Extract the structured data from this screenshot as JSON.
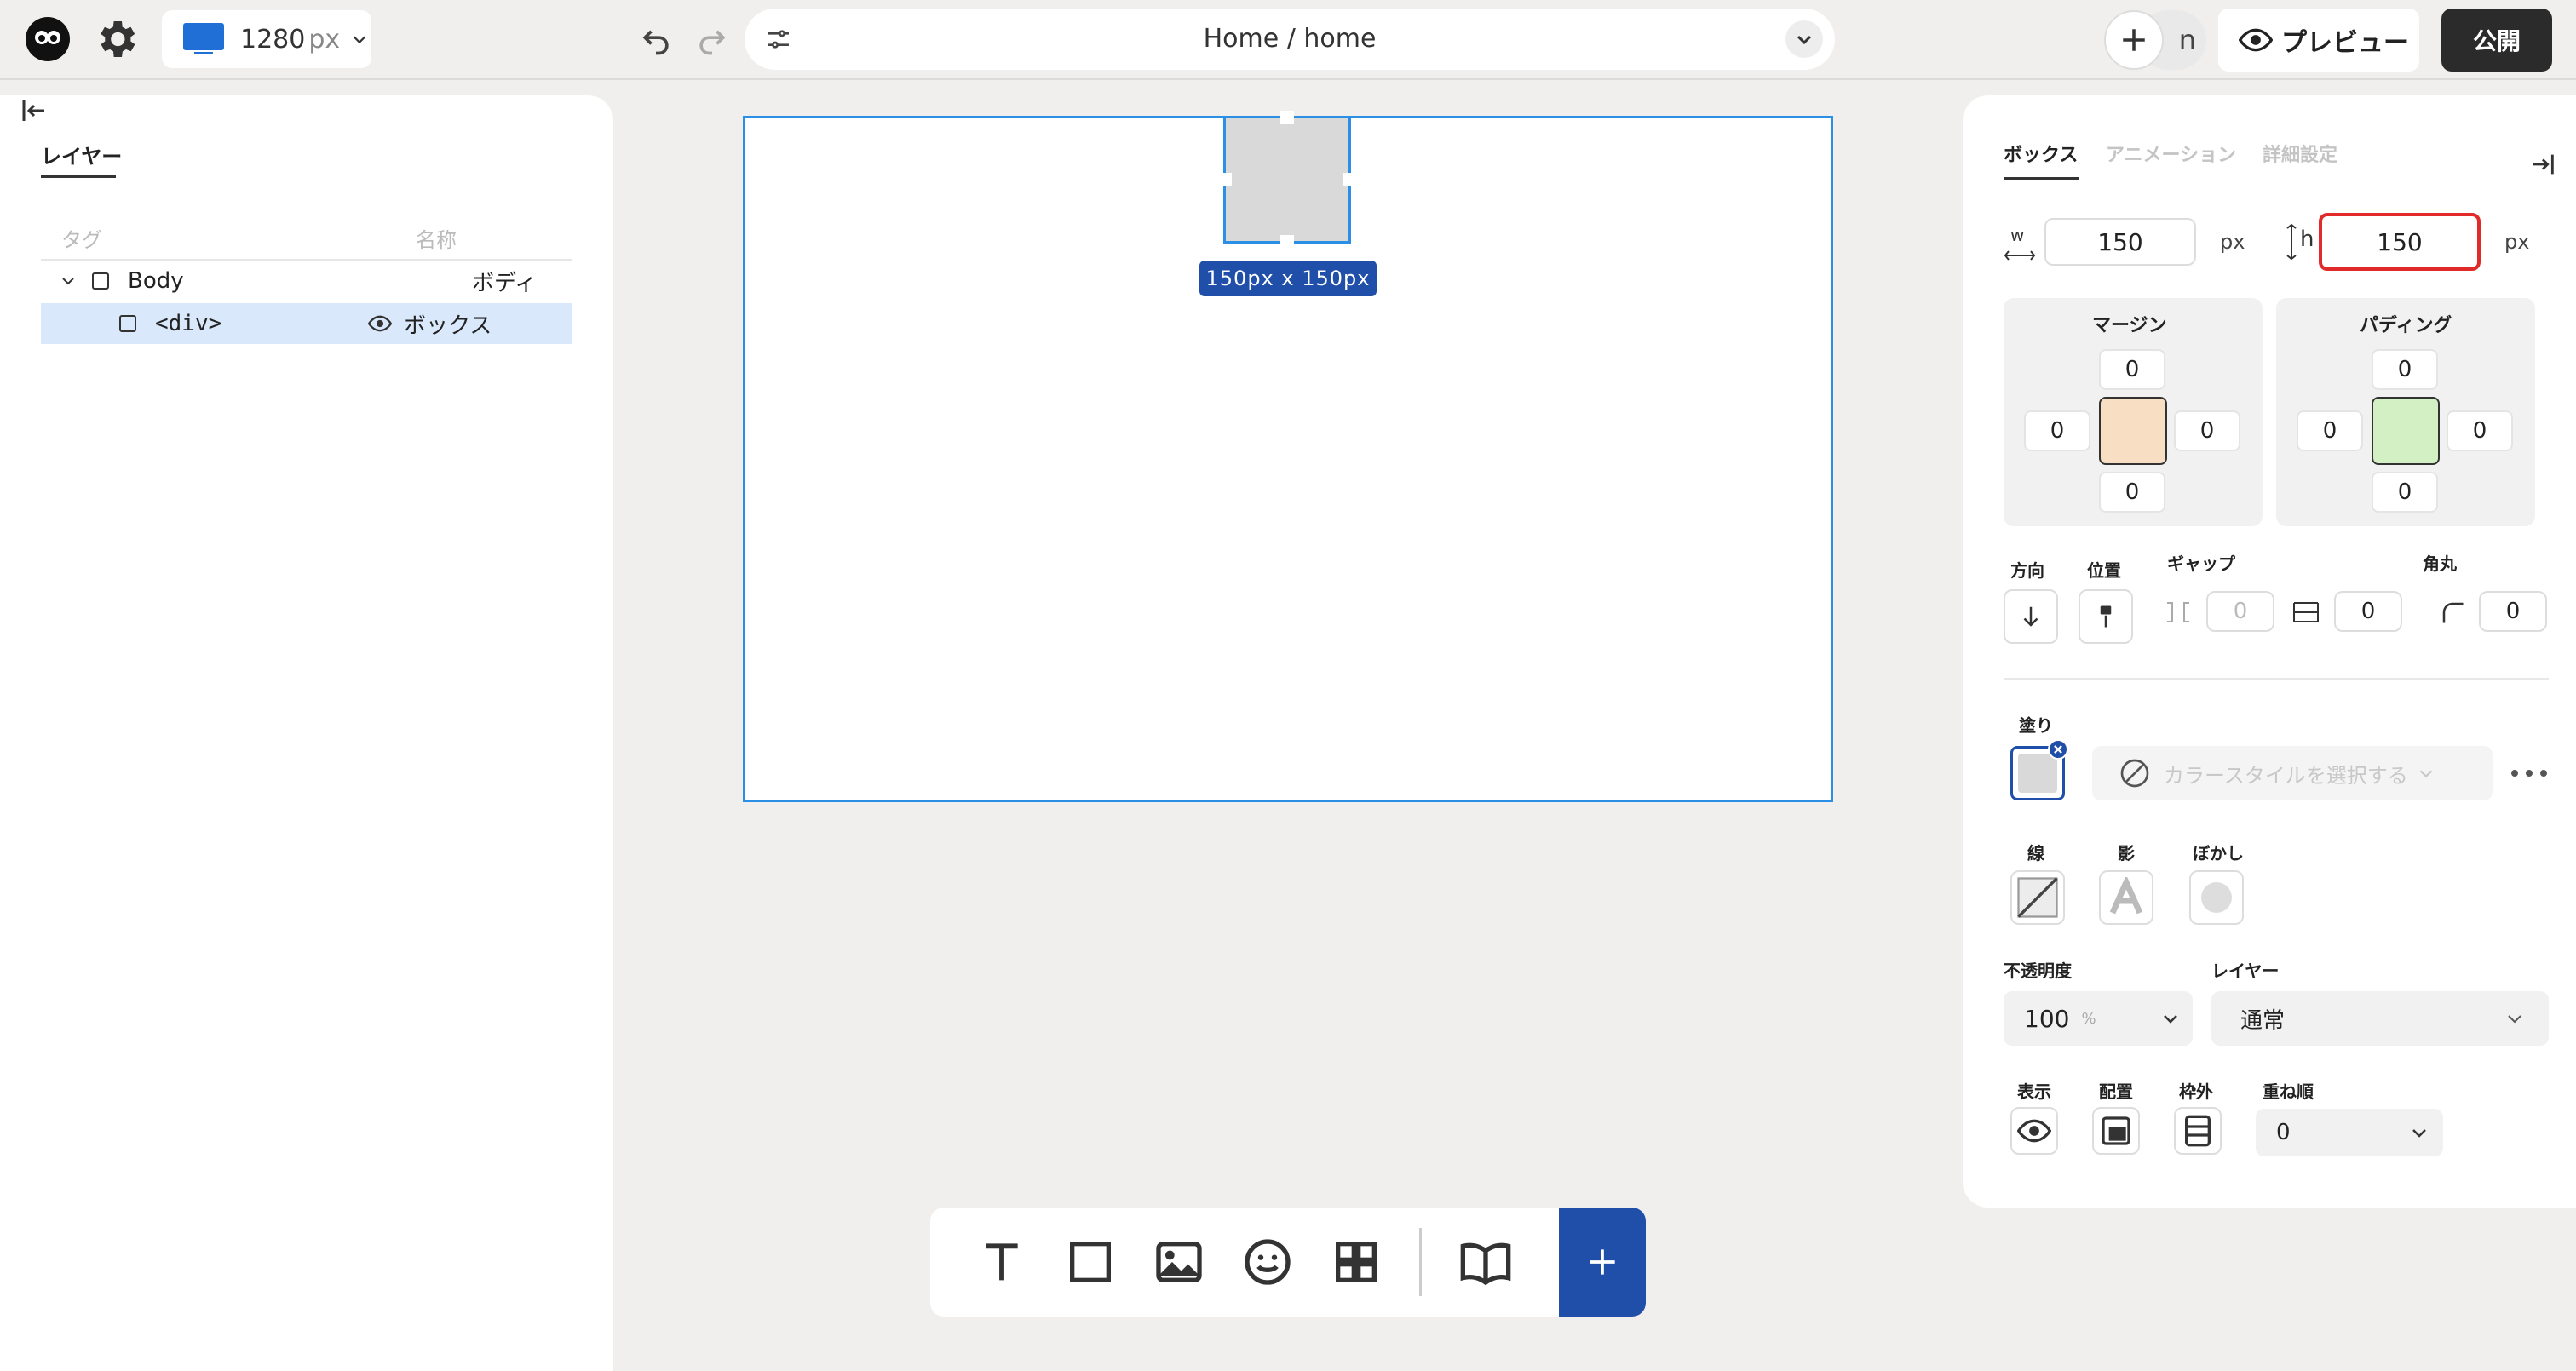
{
  "topbar": {
    "device_width": "1280",
    "device_unit": "px",
    "breadcrumb": "Home  / home",
    "avatar_initial": "n",
    "preview_label": "プレビュー",
    "publish_label": "公開"
  },
  "left_panel": {
    "tab_label": "レイヤー",
    "col_tag": "タグ",
    "col_name": "名称",
    "layers": [
      {
        "tag": "Body",
        "name": "ボディ"
      },
      {
        "tag": "<div>",
        "name": "ボックス"
      }
    ]
  },
  "canvas": {
    "size_badge": "150px x 150px"
  },
  "right_panel": {
    "tabs": [
      "ボックス",
      "アニメーション",
      "詳細設定"
    ],
    "width_label": "w",
    "width_value": "150",
    "width_unit": "px",
    "height_label": "h",
    "height_value": "150",
    "height_unit": "px",
    "margin": {
      "label": "マージン",
      "top": "0",
      "left": "0",
      "right": "0",
      "bottom": "0"
    },
    "padding": {
      "label": "パディング",
      "top": "0",
      "left": "0",
      "right": "0",
      "bottom": "0"
    },
    "direction_label": "方向",
    "position_label": "位置",
    "gap_label": "ギャップ",
    "gap_row_value": "0",
    "gap_col_value": "0",
    "radius_label": "角丸",
    "radius_value": "0",
    "fill_label": "塗り",
    "color_style_placeholder": "カラースタイルを選択する",
    "stroke_label": "線",
    "shadow_label": "影",
    "blur_label": "ぼかし",
    "opacity_label": "不透明度",
    "opacity_value": "100",
    "opacity_unit": "%",
    "layer_label": "レイヤー",
    "blend_value": "通常",
    "display_label": "表示",
    "layout_label": "配置",
    "overflow_label": "枠外",
    "zindex_label": "重ね順",
    "zindex_value": "0"
  },
  "colors": {
    "accent": "#1f4fa8",
    "selection": "#2b8fe6",
    "highlight_border": "#e12b2b",
    "margin_fill": "#f8dfc3",
    "padding_fill": "#d2f0c4"
  }
}
